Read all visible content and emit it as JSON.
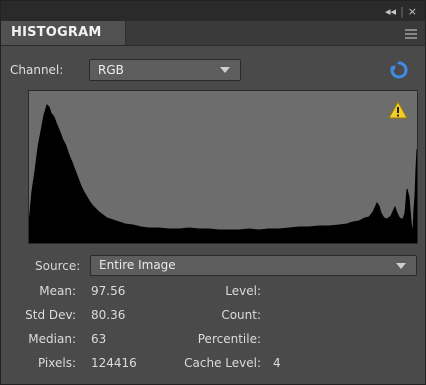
{
  "panel": {
    "title": "HISTOGRAM",
    "controls": {
      "collapse": "◂◂",
      "close": "×"
    },
    "menu_icon": "panel-menu-icon"
  },
  "channel": {
    "label": "Channel:",
    "value": "RGB"
  },
  "histogram": {
    "icons": [
      "refresh-icon",
      "warning-icon"
    ],
    "bar_color": "#000000",
    "background": "#6d6d6d"
  },
  "source": {
    "label": "Source:",
    "value": "Entire Image"
  },
  "stats": {
    "mean_label": "Mean:",
    "mean_value": "97.56",
    "stddev_label": "Std Dev:",
    "stddev_value": "80.36",
    "median_label": "Median:",
    "median_value": "63",
    "pixels_label": "Pixels:",
    "pixels_value": "124416",
    "level_label": "Level:",
    "level_value": "",
    "count_label": "Count:",
    "count_value": "",
    "percentile_label": "Percentile:",
    "percentile_value": "",
    "cache_level_label": "Cache Level:",
    "cache_level_value": "4"
  }
}
